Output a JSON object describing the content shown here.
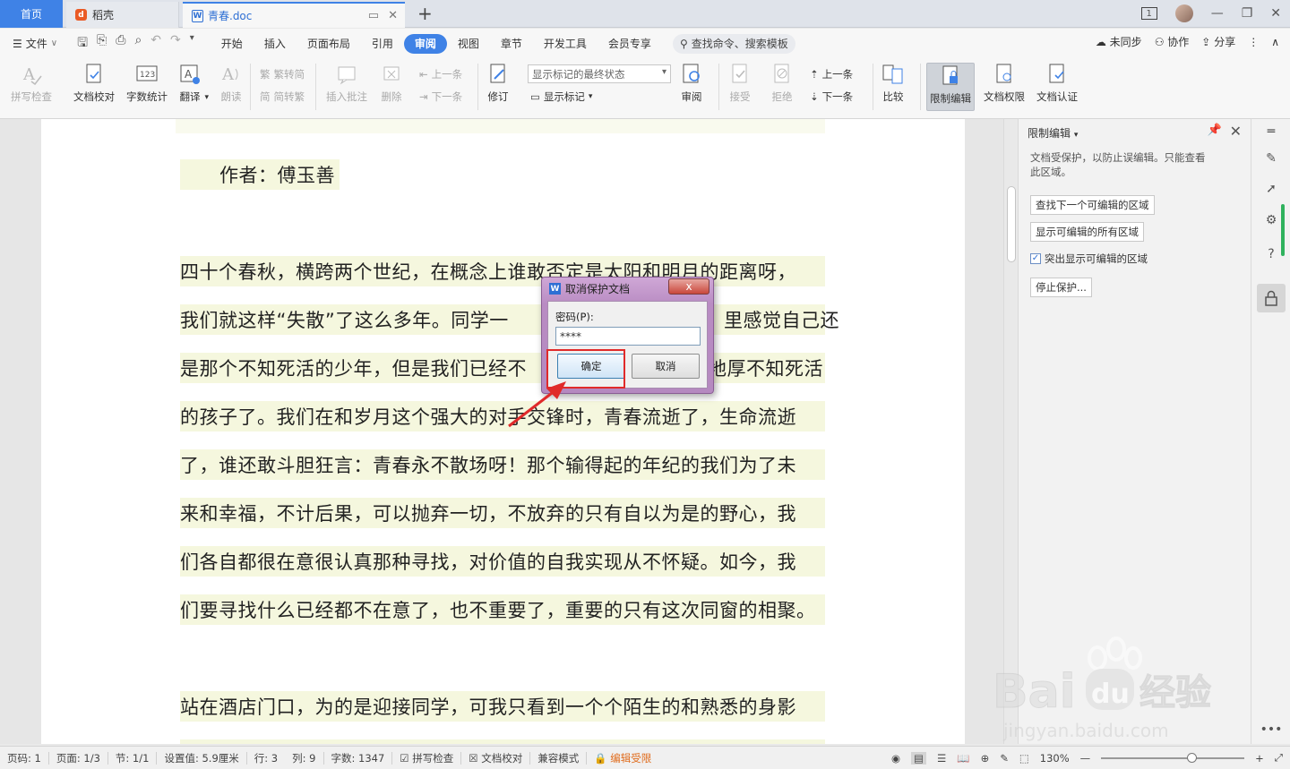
{
  "tabs": {
    "home": "首页",
    "daoke": "稻壳",
    "doc": "青春.doc",
    "page_badge": "1"
  },
  "menu": {
    "file": "文件",
    "items": [
      "开始",
      "插入",
      "页面布局",
      "引用",
      "审阅",
      "视图",
      "章节",
      "开发工具",
      "会员专享"
    ],
    "active": "审阅",
    "search": "查找命令、搜索模板",
    "sync": "未同步",
    "collab": "协作",
    "share": "分享"
  },
  "ribbon": {
    "spellcheck": "拼写检查",
    "proof": "文档校对",
    "wordcount": "字数统计",
    "translate": "翻译",
    "read": "朗读",
    "trad": "繁转简",
    "simp": "简转繁",
    "insert_comment": "插入批注",
    "delete": "删除",
    "prev": "上一条",
    "next": "下一条",
    "revise": "修订",
    "markup_state": "显示标记的最终状态",
    "show_markup": "显示标记",
    "review": "审阅",
    "accept": "接受",
    "reject": "拒绝",
    "prev2": "上一条",
    "next2": "下一条",
    "compare": "比较",
    "restrict": "限制编辑",
    "doc_rights": "文档权限",
    "doc_cert": "文档认证",
    "wordcount_icon_text": "123"
  },
  "document": {
    "author": "作者：傅玉善",
    "lines": [
      "四十个春秋，横跨两个世纪，在概念上谁敢否定是太阳和明月的距离呀，",
      "我们就这样“失散”了这么多年。同学一",
      "是那个不知死活的少年，但是我们已经不",
      "的孩子了。我们在和岁月这个强大的对手交锋时，青春流逝了，生命流逝",
      "了，谁还敢斗胆狂言：青春永不散场呀！那个输得起的年纪的我们为了未",
      "来和幸福，不计后果，可以抛弃一切，不放弃的只有自以为是的野心，我",
      "们各自都很在意很认真那种寻找，对价值的自我实现从不怀疑。如今，我",
      "们要寻找什么已经都不在意了，也不重要了，重要的只有这次同窗的相聚。",
      "站在酒店门口，为的是迎接同学，可我只看到一个个陌生的和熟悉的身影"
    ],
    "line2_tail": "里感觉自己还",
    "line3_tail": "地厚不知死活"
  },
  "dialog": {
    "title": "取消保护文档",
    "close": "x",
    "password_label": "密码(P):",
    "password_value": "****",
    "ok": "确定",
    "cancel": "取消"
  },
  "panel": {
    "title": "限制编辑",
    "desc": "文档受保护，以防止误编辑。只能查看此区域。",
    "find_next": "查找下一个可编辑的区域",
    "show_all": "显示可编辑的所有区域",
    "highlight": "突出显示可编辑的区域",
    "stop": "停止保护..."
  },
  "status": {
    "page": "页码: 1",
    "pages": "页面: 1/3",
    "section": "节: 1/1",
    "setting": "设置值: 5.9厘米",
    "row": "行: 3",
    "col": "列: 9",
    "words": "字数: 1347",
    "spell": "拼写检查",
    "proof": "文档校对",
    "compat": "兼容模式",
    "restricted": "编辑受限",
    "zoom": "130%"
  },
  "watermark": {
    "text_latin": "Bai",
    "text_du": "du",
    "text_cn": "经验",
    "url": "jingyan.baidu.com"
  },
  "colors": {
    "accent": "#3f82e6",
    "highlight_red": "#e02a2a",
    "restricted_orange": "#e06c1d",
    "dialog_frame": "#b98cc3"
  }
}
